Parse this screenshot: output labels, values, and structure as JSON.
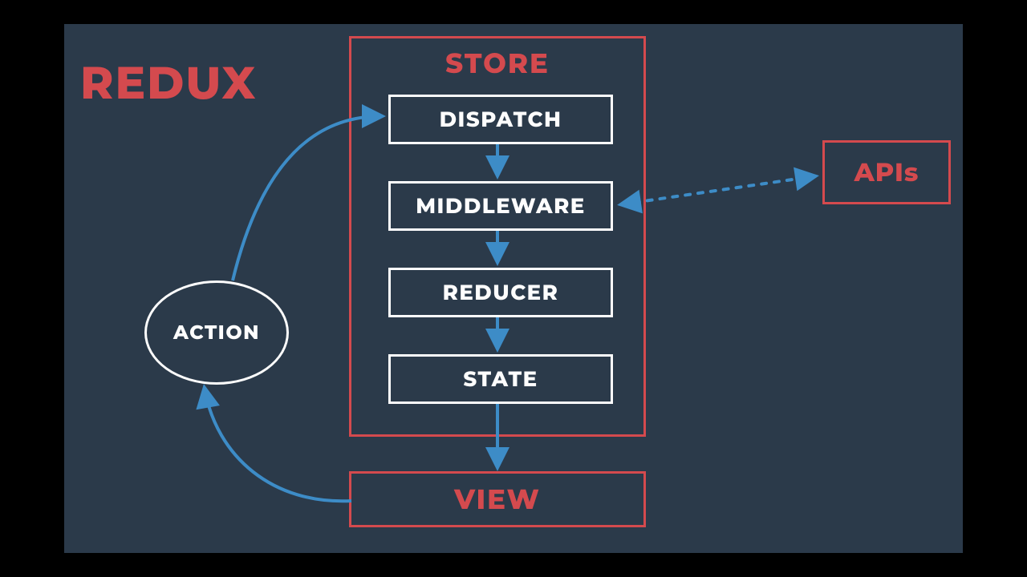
{
  "title": "REDUX",
  "store": {
    "title": "STORE",
    "boxes": {
      "dispatch": "DISPATCH",
      "middleware": "MIDDLEWARE",
      "reducer": "REDUCER",
      "state": "STATE"
    }
  },
  "view": "VIEW",
  "apis": "APIs",
  "action": "ACTION",
  "colors": {
    "background_outer": "#000000",
    "background_panel": "#2b3a4a",
    "accent_red": "#d44a4e",
    "arrow_blue": "#3d8cc7",
    "white": "#fdfdfd"
  },
  "flow": [
    {
      "from": "ACTION",
      "to": "DISPATCH",
      "style": "curve-solid"
    },
    {
      "from": "DISPATCH",
      "to": "MIDDLEWARE",
      "style": "solid"
    },
    {
      "from": "MIDDLEWARE",
      "to": "REDUCER",
      "style": "solid"
    },
    {
      "from": "REDUCER",
      "to": "STATE",
      "style": "solid"
    },
    {
      "from": "STATE",
      "to": "VIEW",
      "style": "solid"
    },
    {
      "from": "VIEW",
      "to": "ACTION",
      "style": "curve-solid"
    },
    {
      "from": "MIDDLEWARE",
      "to": "APIs",
      "style": "dotted-bidirectional"
    }
  ]
}
